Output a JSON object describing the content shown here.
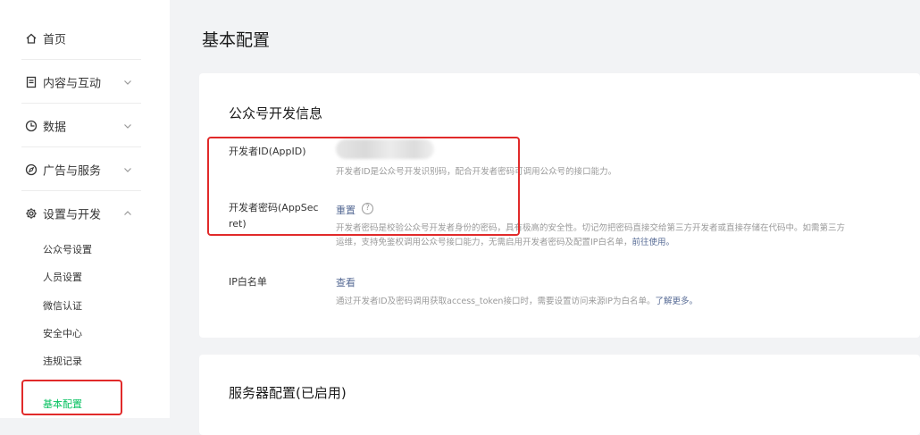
{
  "sidebar": {
    "items": [
      {
        "label": "首页",
        "icon": "home-icon"
      },
      {
        "label": "内容与互动",
        "icon": "document-icon"
      },
      {
        "label": "数据",
        "icon": "pie-chart-icon"
      },
      {
        "label": "广告与服务",
        "icon": "compass-icon"
      },
      {
        "label": "设置与开发",
        "icon": "gear-icon"
      }
    ],
    "sub_items": [
      {
        "label": "公众号设置"
      },
      {
        "label": "人员设置"
      },
      {
        "label": "微信认证"
      },
      {
        "label": "安全中心"
      },
      {
        "label": "违规记录"
      },
      {
        "label": "基本配置"
      }
    ]
  },
  "main": {
    "title": "基本配置",
    "dev_card": {
      "title": "公众号开发信息",
      "appid": {
        "label": "开发者ID(AppID)",
        "desc": "开发者ID是公众号开发识别码，配合开发者密码可调用公众号的接口能力。"
      },
      "secret": {
        "label_line1": "开发者密码(AppSec",
        "label_line2": "ret)",
        "link": "重置",
        "help": "?",
        "desc_line1": "开发者密码是校验公众号开发者身份的密码，具有极高的安全性。切记勿把密码直接交给第三方开发者或直接存储在代码中。如需第三方",
        "desc_line2_prefix": "运维，支持免鉴权调用公众号接口能力，无需启用开发者密码及配置IP白名单，",
        "desc_line2_link": "前往使用。"
      },
      "ip": {
        "label": "IP白名单",
        "link": "查看",
        "desc_prefix": "通过开发者ID及密码调用获取access_token接口时，需要设置访问来源IP为白名单。",
        "desc_link": "了解更多。"
      }
    },
    "server_card": {
      "title": "服务器配置(已启用)"
    }
  },
  "colors": {
    "accent": "#07c160",
    "link": "#576b95",
    "highlight": "#e12a2a"
  }
}
